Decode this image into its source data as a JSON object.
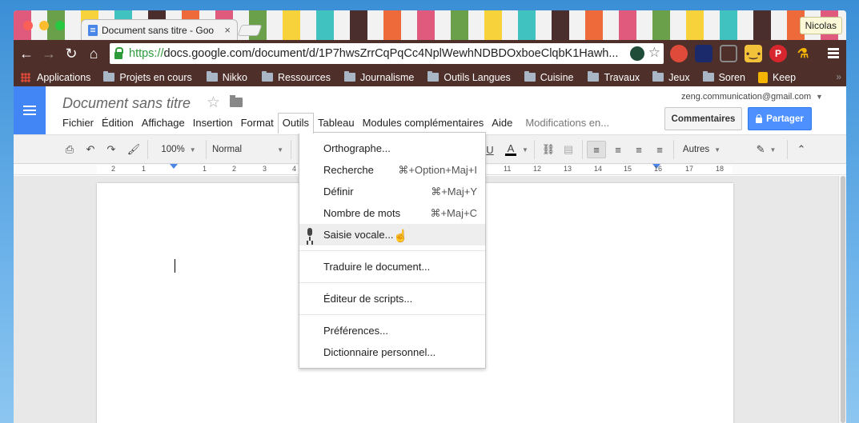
{
  "browser": {
    "tab_title": "Document sans titre - Goo",
    "tab_close": "×",
    "profile_name": "Nicolas",
    "url_scheme": "https://",
    "url_rest": "docs.google.com/document/d/1P7hwsZrrCqPqCc4NplWewhNDBDOxboeClqbK1Hawh...",
    "bookmarks": [
      "Applications",
      "Projets en cours",
      "Nikko",
      "Ressources",
      "Journalisme",
      "Outils Langues",
      "Cuisine",
      "Travaux",
      "Jeux",
      "Soren",
      "Keep"
    ],
    "bookmarks_more": "»"
  },
  "docs": {
    "title": "Document sans titre",
    "account": "zeng.communication@gmail.com",
    "menu": [
      "Fichier",
      "Édition",
      "Affichage",
      "Insertion",
      "Format",
      "Outils",
      "Tableau",
      "Modules complémentaires",
      "Aide"
    ],
    "save_status": "Modifications en...",
    "comments_button": "Commentaires",
    "share_button": "Partager"
  },
  "toolbar": {
    "zoom": "100%",
    "style": "Normal",
    "more": "Autres",
    "underline": "U",
    "text_color": "A"
  },
  "ruler": {
    "ticks": [
      "2",
      "1",
      "1",
      "2",
      "3",
      "4",
      "11",
      "12",
      "13",
      "14",
      "15",
      "16",
      "17",
      "18"
    ]
  },
  "tools_menu": {
    "items": [
      {
        "label": "Orthographe...",
        "shortcut": ""
      },
      {
        "label": "Recherche",
        "shortcut": "⌘+Option+Maj+I"
      },
      {
        "label": "Définir",
        "shortcut": "⌘+Maj+Y"
      },
      {
        "label": "Nombre de mots",
        "shortcut": "⌘+Maj+C"
      },
      {
        "label": "Saisie vocale...",
        "shortcut": ""
      },
      {
        "label": "Traduire le document...",
        "shortcut": ""
      },
      {
        "label": "Éditeur de scripts...",
        "shortcut": ""
      },
      {
        "label": "Préférences...",
        "shortcut": ""
      },
      {
        "label": "Dictionnaire personnel...",
        "shortcut": ""
      }
    ]
  },
  "colors": {
    "docs_blue": "#4285f4",
    "share_blue": "#4d90fe",
    "chrome_frame": "#4e2f2a",
    "secure_green": "#2e9b3a"
  }
}
